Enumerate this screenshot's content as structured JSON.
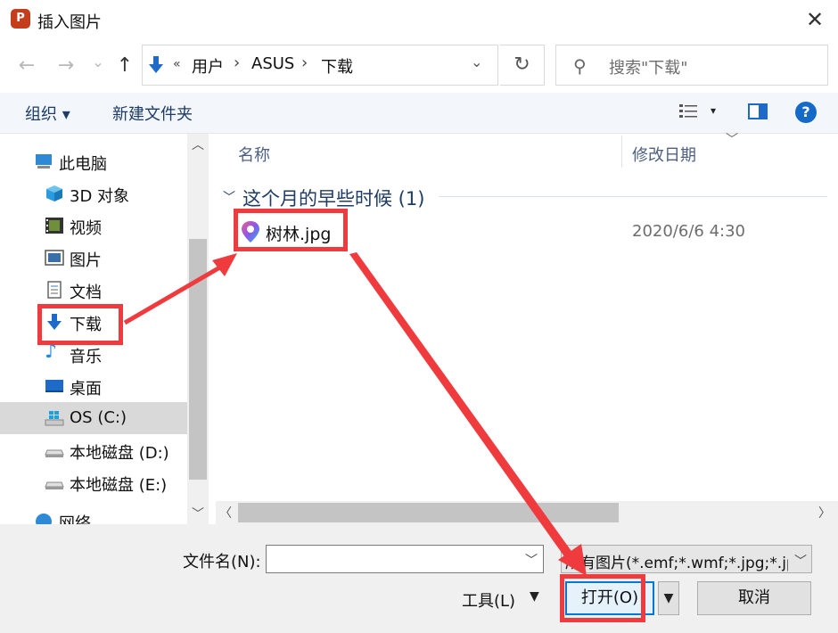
{
  "window": {
    "app_icon_letter": "P",
    "title": "插入图片"
  },
  "nav": {
    "back": "←",
    "forward": "→",
    "recent": "⌄",
    "up": "↑",
    "breadcrumb_overflow": "«",
    "breadcrumbs": [
      "用户",
      "ASUS",
      "下载"
    ],
    "separator": "›",
    "refresh": "↻",
    "search_placeholder": "搜索\"下载\""
  },
  "toolbar": {
    "organize": "组织 ▾",
    "new_folder": "新建文件夹",
    "view_dropdown": "▾",
    "help": "?"
  },
  "sidebar": {
    "items": [
      {
        "label": "此电脑",
        "icon": "computer-icon"
      },
      {
        "label": "3D 对象",
        "icon": "cube-icon"
      },
      {
        "label": "视频",
        "icon": "video-icon"
      },
      {
        "label": "图片",
        "icon": "pictures-icon"
      },
      {
        "label": "文档",
        "icon": "document-icon"
      },
      {
        "label": "下载",
        "icon": "download-icon"
      },
      {
        "label": "音乐",
        "icon": "music-icon"
      },
      {
        "label": "桌面",
        "icon": "desktop-icon"
      },
      {
        "label": "OS (C:)",
        "icon": "drive-windows-icon"
      },
      {
        "label": "本地磁盘 (D:)",
        "icon": "drive-icon"
      },
      {
        "label": "本地磁盘 (E:)",
        "icon": "drive-icon"
      },
      {
        "label": "网络",
        "icon": "network-icon"
      }
    ],
    "selected": "OS (C:)"
  },
  "files": {
    "columns": {
      "name": "名称",
      "date": "修改日期"
    },
    "group": {
      "title": "这个月的早些时候 (1)"
    },
    "rows": [
      {
        "name": "树林.jpg",
        "date": "2020/6/6 4:30",
        "icon": "jpg-image-icon"
      }
    ]
  },
  "footer": {
    "filename_label": "文件名(N):",
    "filename_value": "",
    "filter_value": "所有图片(*.emf;*.wmf;*.jpg;*.jp",
    "tools": "工具(L)",
    "open": "打开(O)",
    "cancel": "取消"
  },
  "colors": {
    "annotation_red": "#ef3b3e",
    "accent_blue": "#1d6ac9",
    "group_title": "#1e3c66",
    "app_icon_bg": "#c43e1c"
  }
}
